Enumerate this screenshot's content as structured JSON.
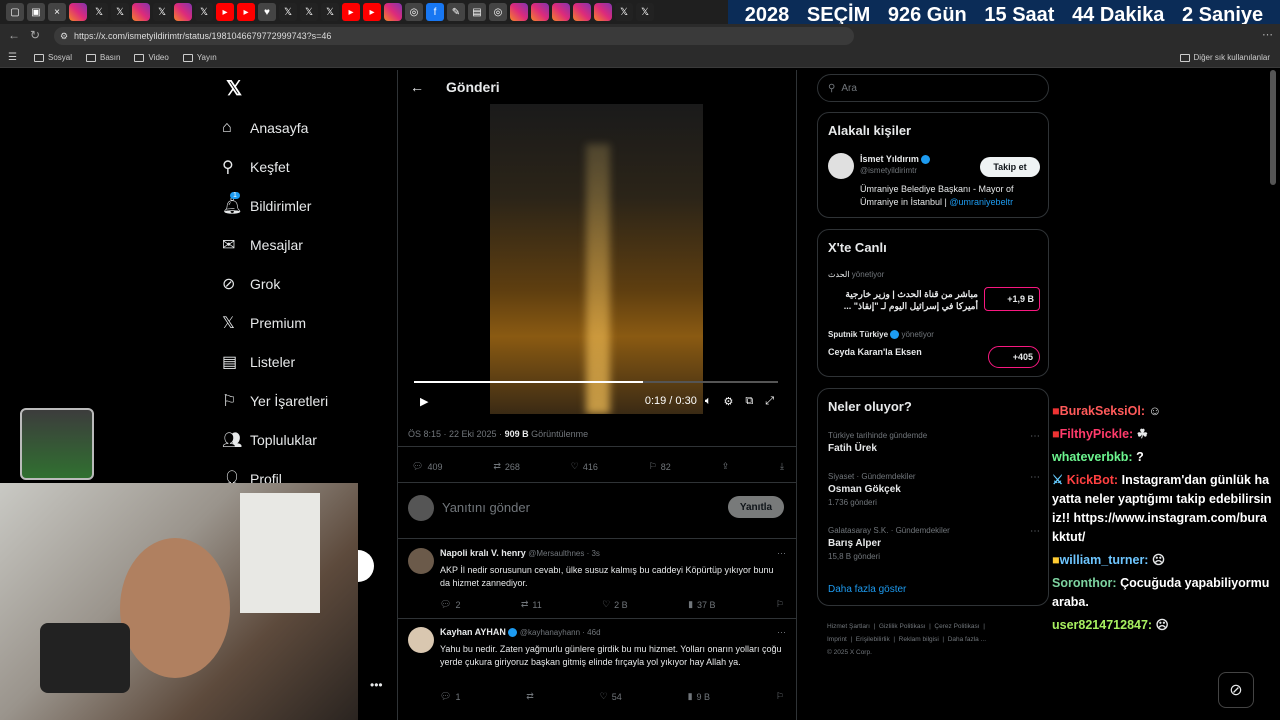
{
  "browser": {
    "url": "https://x.com/ismetyildirimtr/status/1981046679772999743?s=46",
    "bookmarks": [
      "Sosyal",
      "Basın",
      "Video",
      "Yayın"
    ],
    "bookmarks_right": "Diğer sık kullanılanlar"
  },
  "countdown": {
    "year": "2028",
    "label": "SEÇİM",
    "days": "926 Gün",
    "hours": "15 Saat",
    "minutes": "44 Dakika",
    "seconds": "2 Saniye"
  },
  "nav": {
    "items": [
      {
        "label": "Anasayfa",
        "icon": "home-icon"
      },
      {
        "label": "Keşfet",
        "icon": "search-icon"
      },
      {
        "label": "Bildirimler",
        "icon": "bell-icon",
        "badge": "1"
      },
      {
        "label": "Mesajlar",
        "icon": "mail-icon"
      },
      {
        "label": "Grok",
        "icon": "grok-icon"
      },
      {
        "label": "Premium",
        "icon": "x-icon"
      },
      {
        "label": "Listeler",
        "icon": "list-icon"
      },
      {
        "label": "Yer İşaretleri",
        "icon": "bookmark-icon"
      },
      {
        "label": "Topluluklar",
        "icon": "people-icon"
      },
      {
        "label": "Profil",
        "icon": "profile-icon"
      }
    ]
  },
  "post": {
    "header": "Gönderi",
    "video_time": "0:19 / 0:30",
    "video_progress": 0.63,
    "timestamp": "ÖS 8:15 · 22 Eki 2025 ·",
    "views": "909 B",
    "views_label": "Görüntülenme",
    "replies": "409",
    "retweets": "268",
    "likes": "416",
    "bookmarks": "82",
    "reply_placeholder": "Yanıtını gönder",
    "reply_button": "Yanıtla"
  },
  "replies": [
    {
      "name": "Napoli kralı V. henry",
      "handle": "@Mersaulthnes · 3s",
      "text": "AKP İl nedir sorusunun cevabı, ülke susuz kalmış bu caddeyi Köpürtüp yıkıyor bunu da hizmet zannediyor.",
      "replies": "2",
      "retweets": "11",
      "likes": "2 B",
      "views": "37 B"
    },
    {
      "name": "Kayhan AYHAN",
      "handle": "@kayhanayhann · 46d",
      "text": "Yahu bu nedir. Zaten yağmurlu günlere girdik bu mu hizmet. Yolları onarın yolları çoğu yerde çukura giriyoruz başkan gitmiş elinde fırçayla yol yıkıyor hay Allah ya.",
      "replies": "1",
      "retweets": "",
      "likes": "54",
      "views": "9 B"
    }
  ],
  "sidebar": {
    "search_placeholder": "Ara",
    "related_title": "Alakalı kişiler",
    "person_name": "İsmet Yıldırım",
    "person_handle": "@ismetyildirimtr",
    "person_bio": "Ümraniye Belediye Başkanı - Mayor of Ümraniye in İstanbul |",
    "person_bio_link": "@umraniyebeltr",
    "follow_button": "Takip et",
    "live_title": "X'te Canlı",
    "live1_host": "الحدث",
    "live1_manages": "yönetiyor",
    "live1_text": "مباشر من قناة الحدث | وزير خارجية أميركا في إسرائيل اليوم لـ \"إنقاذ\" ...",
    "live1_count": "+1,9 B",
    "live2_host": "Sputnik Türkiye",
    "live2_manages": "yönetiyor",
    "live2_text": "Ceyda Karan'la Eksen",
    "live2_count": "+405",
    "trends_title": "Neler oluyor?",
    "trends": [
      {
        "context": "Türkiye tarihinde gündemde",
        "name": "Fatih Ürek",
        "count": ""
      },
      {
        "context": "Siyaset · Gündemdekiler",
        "name": "Osman Gökçek",
        "count": "1.736 gönderi"
      },
      {
        "context": "Galatasaray S.K. · Gündemdekiler",
        "name": "Barış Alper",
        "count": "15,8 B gönderi"
      }
    ],
    "show_more": "Daha fazla göster",
    "footer": [
      "Hizmet Şartları",
      "Gizlilik Politikası",
      "Çerez Politikası",
      "Imprint",
      "Erişilebilirlik",
      "Reklam bilgisi",
      "Daha fazla ...",
      "© 2025 X Corp."
    ]
  },
  "chat": [
    {
      "user": "BurakSeksiOl:",
      "msg": "",
      "color": "#ff5a5a"
    },
    {
      "user": "FilthyPickle:",
      "msg": "",
      "color": "#ff3b6b"
    },
    {
      "user": "whateverbkb:",
      "msg": "?",
      "color": "#6cf58f"
    },
    {
      "user": "KickBot:",
      "msg": "Instagram'dan günlük hayatta neler yaptığımı takip edebilirsiniz!! https://www.instagram.com/burakktut/",
      "color": "#ff4040"
    },
    {
      "user": "william_turner:",
      "msg": "",
      "color": "#6ec6ff"
    },
    {
      "user": "Soronthor:",
      "msg": "Çocuğuda yapabiliyormu araba.",
      "color": "#7dd3a0"
    },
    {
      "user": "user8214712847:",
      "msg": "",
      "color": "#a8f060"
    }
  ]
}
